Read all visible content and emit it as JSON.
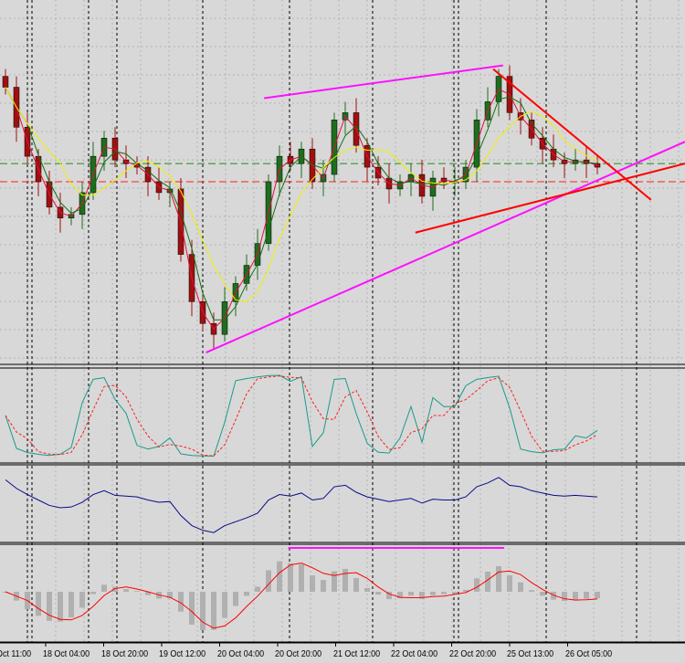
{
  "chart_data": {
    "type": "candlestick",
    "title": "",
    "colors": {
      "bg": "#d8d8d8",
      "bull": "#1e6e1e",
      "bear": "#a01010",
      "ma_fast": "#e0103c",
      "ma_mid": "#107010",
      "ma_slow": "#f0f000",
      "trend_magenta": "#ff10ff",
      "trend_red": "#ff0000",
      "stoch_main": "#1a9a8a",
      "stoch_signal": "#ff2020",
      "osc": "#0a0a8a",
      "macd_hist": "#b0b0b0",
      "macd_signal": "#ff0000"
    },
    "ylim": [
      0,
      100
    ],
    "closes": [
      76,
      65,
      57,
      50,
      43,
      40,
      41,
      47,
      57,
      62,
      56,
      55,
      54,
      50,
      47,
      48,
      30,
      17,
      11,
      8,
      17,
      22,
      27,
      33,
      50,
      57,
      55,
      59,
      50,
      52,
      67,
      69,
      60,
      54,
      51,
      48,
      50,
      52,
      46,
      51,
      50,
      50,
      54,
      67,
      72,
      79,
      69,
      67,
      62,
      59,
      56,
      55,
      56,
      55,
      54
    ],
    "hlines": [
      {
        "value": 55,
        "color": "#1a8a1a"
      },
      {
        "value": 50,
        "color": "#ff2020"
      }
    ],
    "trendlines": [
      {
        "from": [
          23.6,
          73
        ],
        "to": [
          45.4,
          82
        ],
        "color": "#ff10ff"
      },
      {
        "from": [
          18.3,
          3
        ],
        "to": [
          62,
          61
        ],
        "color": "#ff10ff"
      },
      {
        "from": [
          44.5,
          81
        ],
        "to": [
          58.9,
          45
        ],
        "color": "#ff0000"
      },
      {
        "from": [
          37.4,
          36
        ],
        "to": [
          62,
          55
        ],
        "color": "#ff0000"
      },
      {
        "from": [
          25.8,
          76
        ],
        "to": [
          45.5,
          76
        ],
        "color": "#ff10ff",
        "panel": "macd"
      }
    ],
    "x_tick_labels": [
      "Oct 11:00",
      "18 Oct 04:00",
      "18 Oct 20:00",
      "19 Oct 12:00",
      "20 Oct 04:00",
      "20 Oct 20:00",
      "21 Oct 12:00",
      "22 Oct 04:00",
      "22 Oct 20:00",
      "25 Oct 13:00",
      "26 Oct 05:00"
    ]
  }
}
